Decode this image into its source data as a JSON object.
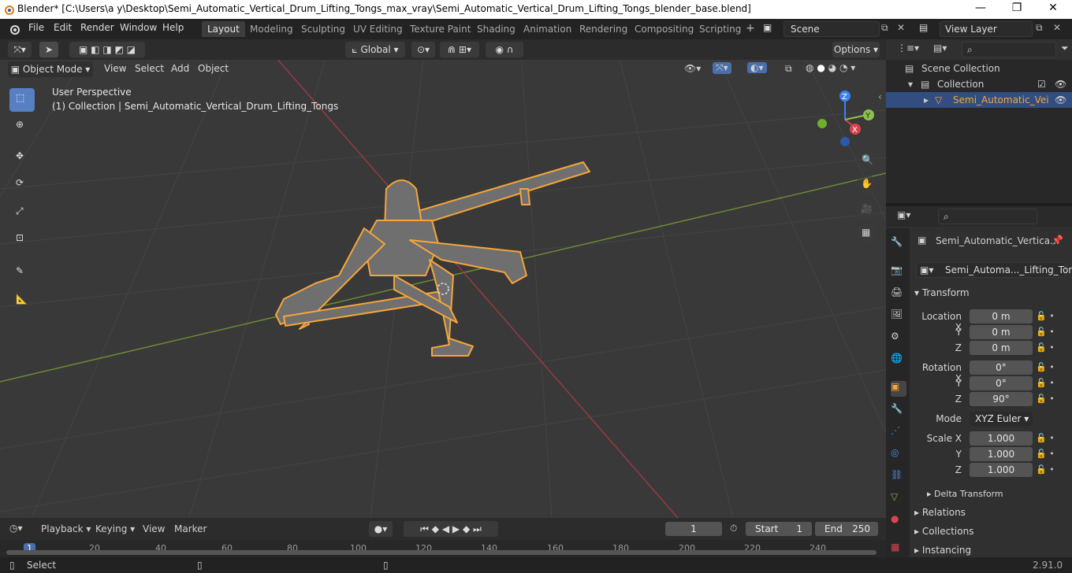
{
  "title_bar": {
    "title": "Blender* [C:\\Users\\a y\\Desktop\\Semi_Automatic_Vertical_Drum_Lifting_Tongs_max_vray\\Semi_Automatic_Vertical_Drum_Lifting_Tongs_blender_base.blend]",
    "minimize": "—",
    "maximize": "❐",
    "close": "✕"
  },
  "menu": [
    "File",
    "Edit",
    "Render",
    "Window",
    "Help"
  ],
  "workspaces": [
    {
      "label": "Layout",
      "active": true
    },
    {
      "label": "Modeling"
    },
    {
      "label": "Sculpting"
    },
    {
      "label": "UV Editing"
    },
    {
      "label": "Texture Paint"
    },
    {
      "label": "Shading"
    },
    {
      "label": "Animation"
    },
    {
      "label": "Rendering"
    },
    {
      "label": "Compositing"
    },
    {
      "label": "Scripting"
    }
  ],
  "scene": {
    "label": "Scene"
  },
  "view_layer": {
    "label": "View Layer"
  },
  "viewport_header": {
    "transform_orientation": "Global",
    "options": "Options"
  },
  "viewport_header2": {
    "mode": "Object Mode",
    "view": "View",
    "select": "Select",
    "add": "Add",
    "object": "Object"
  },
  "viewport": {
    "perspective": "User Perspective",
    "collection_info": "(1) Collection | Semi_Automatic_Vertical_Drum_Lifting_Tongs",
    "gizmo": {
      "x": "X",
      "y": "Y",
      "z": "Z"
    }
  },
  "outliner": {
    "scene_collection": "Scene Collection",
    "collection": "Collection",
    "object": "Semi_Automatic_Vei"
  },
  "properties": {
    "object_name": "Semi_Automatic_Vertica...",
    "data_name": "Semi_Automa..._Lifting_Tongs",
    "transform": "Transform",
    "location": {
      "label": "Location X",
      "x": "0 m",
      "y": "0 m",
      "z": "0 m"
    },
    "rotation": {
      "label": "Rotation X",
      "x": "0°",
      "y": "0°",
      "z": "90°"
    },
    "axis_y": "Y",
    "axis_z": "Z",
    "mode_label": "Mode",
    "mode_value": "XYZ Euler",
    "scale": {
      "label": "Scale X",
      "x": "1.000",
      "y": "1.000",
      "z": "1.000"
    },
    "delta_transform": "Delta Transform",
    "relations": "Relations",
    "collections": "Collections",
    "instancing": "Instancing"
  },
  "timeline": {
    "playback": "Playback",
    "keying": "Keying",
    "view": "View",
    "marker": "Marker",
    "current_frame": "1",
    "start_label": "Start",
    "start_value": "1",
    "end_label": "End",
    "end_value": "250",
    "ticks": [
      "1",
      "20",
      "40",
      "60",
      "80",
      "100",
      "120",
      "140",
      "160",
      "180",
      "200",
      "220",
      "240"
    ]
  },
  "status_bar": {
    "select": "Select",
    "version": "2.91.0"
  },
  "colors": {
    "accent": "#5680c2",
    "selection_outline": "#f5a53a",
    "object_gray": "#6f6f6f",
    "x_axis": "#d9434e",
    "y_axis": "#8bc34a",
    "z_axis": "#3b82f6"
  }
}
